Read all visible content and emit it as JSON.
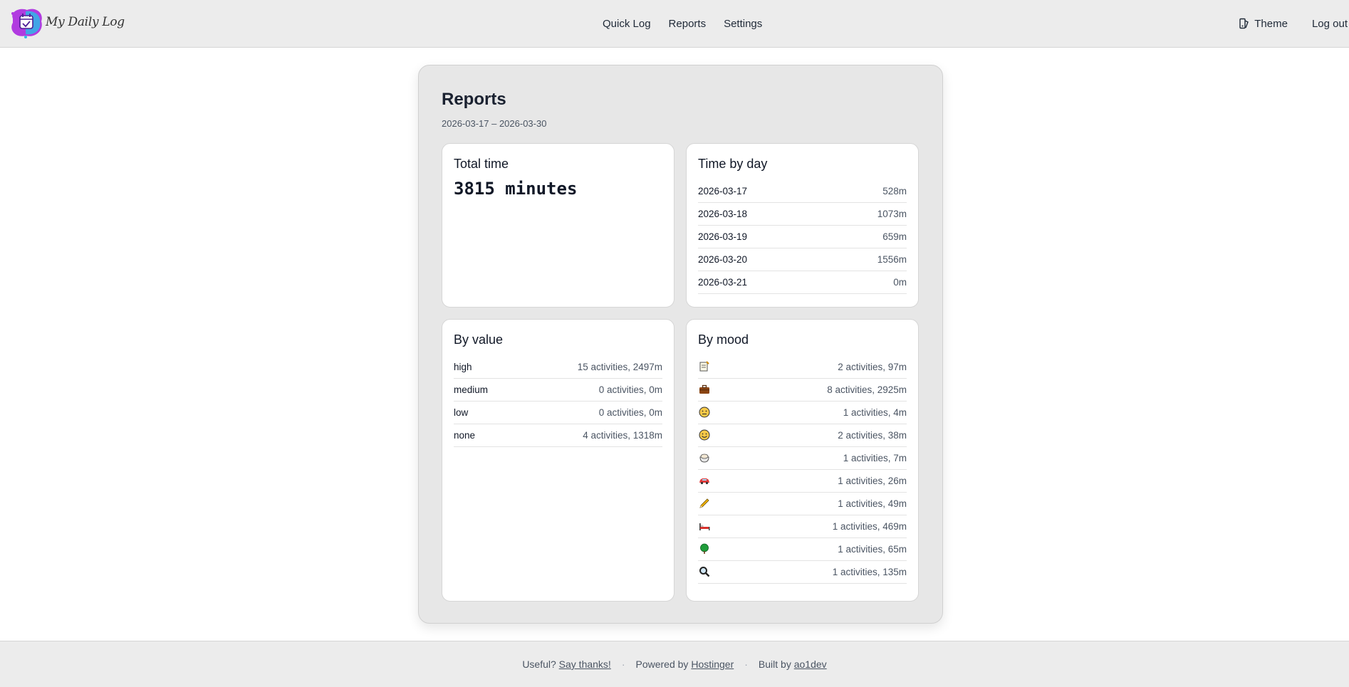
{
  "app": {
    "name": "My Daily Log"
  },
  "nav": {
    "links": [
      "Quick Log",
      "Reports",
      "Settings"
    ],
    "theme_label": "Theme",
    "logout_label": "Log out"
  },
  "report": {
    "title": "Reports",
    "date_range": "2026-03-17 – 2026-03-30",
    "total_time": {
      "title": "Total time",
      "value": "3815 minutes"
    },
    "time_by_day": {
      "title": "Time by day",
      "rows": [
        {
          "date": "2026-03-17",
          "minutes": "528m"
        },
        {
          "date": "2026-03-18",
          "minutes": "1073m"
        },
        {
          "date": "2026-03-19",
          "minutes": "659m"
        },
        {
          "date": "2026-03-20",
          "minutes": "1556m"
        },
        {
          "date": "2026-03-21",
          "minutes": "0m"
        }
      ]
    },
    "by_value": {
      "title": "By value",
      "rows": [
        {
          "label": "high",
          "summary": "15 activities, 2497m"
        },
        {
          "label": "medium",
          "summary": "0 activities, 0m"
        },
        {
          "label": "low",
          "summary": "0 activities, 0m"
        },
        {
          "label": "none",
          "summary": "4 activities, 1318m"
        }
      ]
    },
    "by_mood": {
      "title": "By mood",
      "rows": [
        {
          "icon": "memo-icon",
          "summary": "2 activities, 97m"
        },
        {
          "icon": "briefcase-icon",
          "summary": "8 activities, 2925m"
        },
        {
          "icon": "neutral-face-icon",
          "summary": "1 activities, 4m"
        },
        {
          "icon": "smiling-face-icon",
          "summary": "2 activities, 38m"
        },
        {
          "icon": "bowl-icon",
          "summary": "1 activities, 7m"
        },
        {
          "icon": "car-icon",
          "summary": "1 activities, 26m"
        },
        {
          "icon": "pencil-icon",
          "summary": "1 activities, 49m"
        },
        {
          "icon": "bed-icon",
          "summary": "1 activities, 469m"
        },
        {
          "icon": "tree-icon",
          "summary": "1 activities, 65m"
        },
        {
          "icon": "magnifier-icon",
          "summary": "1 activities, 135m"
        }
      ]
    }
  },
  "footer": {
    "useful_text": "Useful?",
    "thanks_link": "Say thanks!",
    "powered_text": "Powered by",
    "powered_link": "Hostinger",
    "built_text": "Built by",
    "built_link": "ao1dev",
    "separator": "·"
  },
  "colors": {
    "header_bg": "#ececec",
    "card_bg": "#e7e7e7",
    "panel_bg": "#ffffff"
  }
}
